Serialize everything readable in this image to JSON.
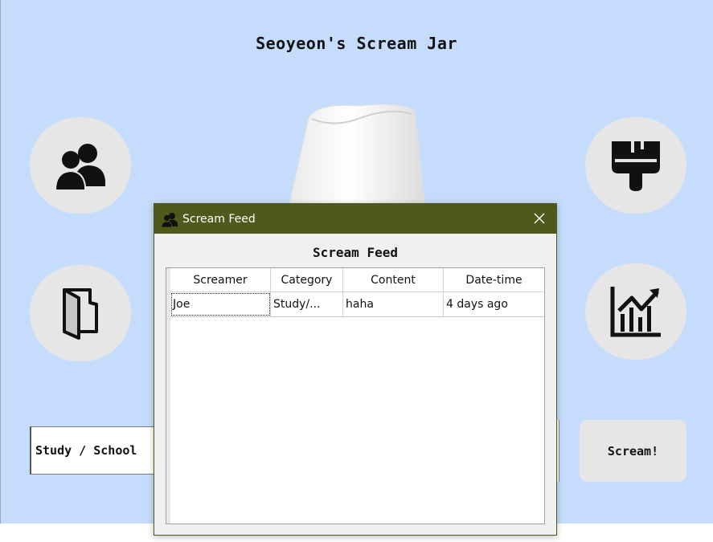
{
  "app": {
    "title": "Seoyeon's Scream Jar",
    "colors": {
      "background": "#c6dcfc",
      "button": "#e6e6e6",
      "dialog_titlebar": "#4d5a1c"
    }
  },
  "buttons": {
    "left_top_icon": "users-icon",
    "left_middle_icon": "open-door-icon",
    "right_top_icon": "paintbrush-icon",
    "right_middle_icon": "chart-icon",
    "scream_label": "Scream!"
  },
  "category": {
    "value": "Study / School"
  },
  "dialog": {
    "window_title": "Scream Feed",
    "heading": "Scream Feed",
    "columns": [
      "Screamer",
      "Category",
      "Content",
      "Date-time"
    ],
    "rows": [
      [
        "Joe",
        "Study/...",
        "haha",
        "4 days ago"
      ]
    ]
  }
}
